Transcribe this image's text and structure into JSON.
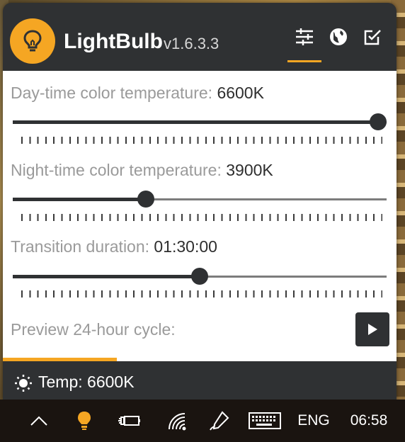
{
  "app": {
    "title": "LightBulb",
    "version": "v1.6.3.3"
  },
  "tabs": [
    {
      "name": "Settings",
      "icon": "sliders-icon",
      "active": true
    },
    {
      "name": "Location",
      "icon": "globe-icon",
      "active": false
    },
    {
      "name": "Exclusions",
      "icon": "checkbox-icon",
      "active": false
    }
  ],
  "settings": {
    "day": {
      "label": "Day-time color temperature:",
      "value": "6600K",
      "fraction": 1.0
    },
    "night": {
      "label": "Night-time color temperature:",
      "value": "3900K",
      "fraction": 0.35
    },
    "transition": {
      "label": "Transition duration:",
      "value": "01:30:00",
      "fraction": 0.5
    }
  },
  "preview": {
    "label": "Preview 24-hour cycle:",
    "progress": 0.29
  },
  "status": {
    "text": "Temp: 6600K",
    "icon": "sun-icon"
  },
  "taskbar": {
    "language": "ENG",
    "time": "06:58"
  },
  "colors": {
    "accent": "#f5a623",
    "dark": "#2f3133",
    "label": "#9a9a9a"
  }
}
